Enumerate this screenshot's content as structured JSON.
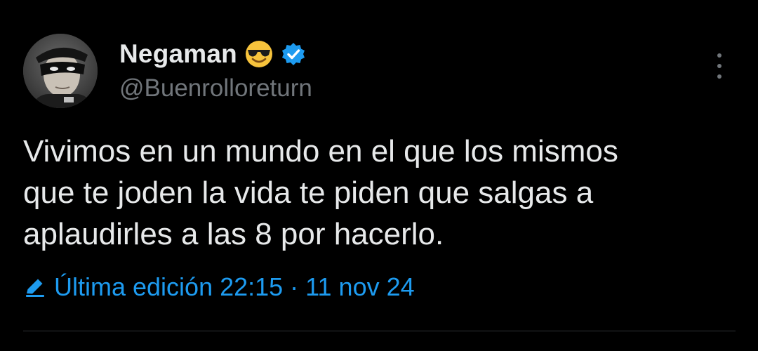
{
  "tweet": {
    "author": {
      "display_name": "Negaman",
      "handle": "@Buenrolloreturn",
      "avatar_icon": "masked-man-avatar",
      "emoji_icon": "smiling-face-with-sunglasses-icon",
      "verified_icon": "verified-badge-icon"
    },
    "text": "Vivimos en un mundo en el que los mismos\nque te joden la vida te piden que salgas a\naplaudirles a las 8 por hacerlo.",
    "edit_info": "Última edición 22:15 · 11 nov 24",
    "edit_icon": "pencil-icon",
    "more_icon": "more-vertical-icon"
  },
  "colors": {
    "background": "#000000",
    "primary_text": "#e7e9ea",
    "secondary_text": "#71767b",
    "accent": "#1d9bf0",
    "divider": "#2f3336"
  }
}
